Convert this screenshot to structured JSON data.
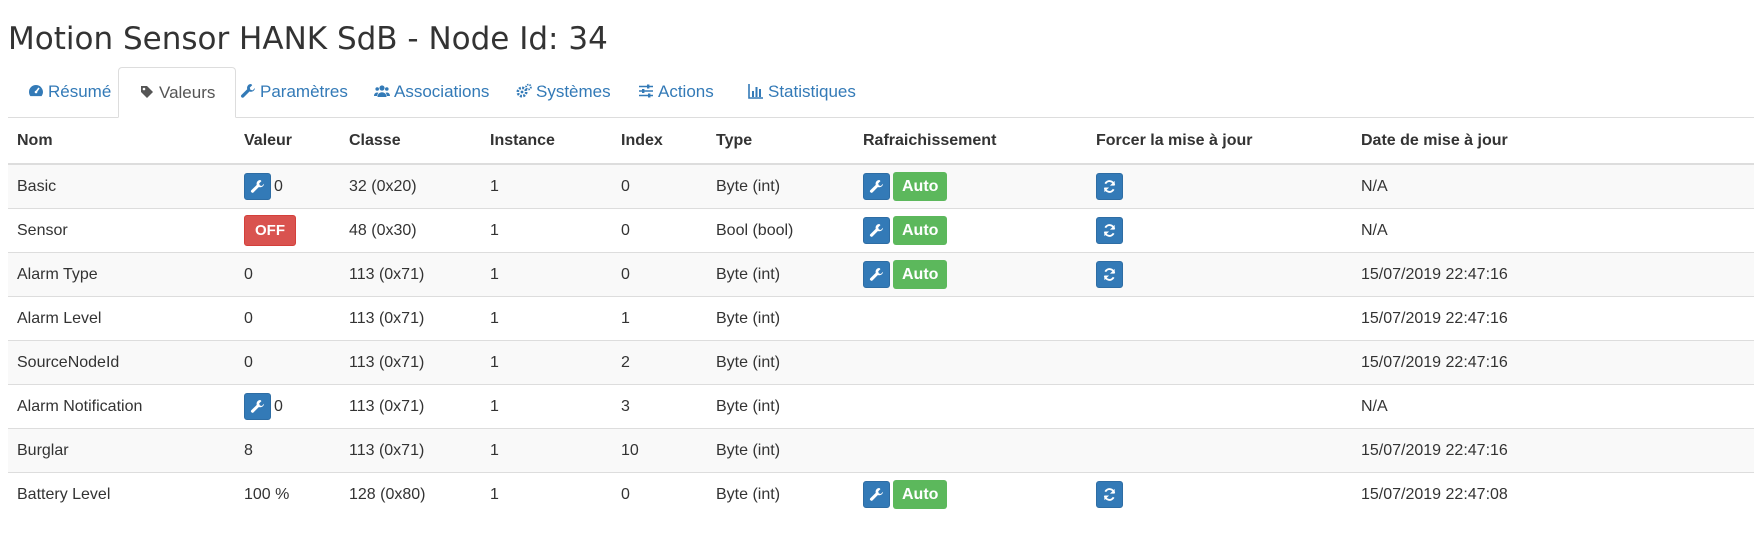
{
  "page": {
    "title": "Motion Sensor HANK SdB - Node Id: 34"
  },
  "tabs": [
    {
      "label": "Résumé",
      "icon": "dashboard-icon"
    },
    {
      "label": "Valeurs",
      "icon": "tag-icon",
      "active": true
    },
    {
      "label": "Paramètres",
      "icon": "wrench-icon"
    },
    {
      "label": "Associations",
      "icon": "users-icon"
    },
    {
      "label": "Systèmes",
      "icon": "cogs-icon"
    },
    {
      "label": "Actions",
      "icon": "sliders-icon"
    },
    {
      "label": "Statistiques",
      "icon": "bar-chart-icon"
    }
  ],
  "table": {
    "headers": [
      "Nom",
      "Valeur",
      "Classe",
      "Instance",
      "Index",
      "Type",
      "Rafraichissement",
      "Forcer la mise à jour",
      "Date de mise à jour"
    ],
    "rows": [
      {
        "name": "Basic",
        "value": "0",
        "class": "32 (0x20)",
        "instance": "1",
        "index": "0",
        "type": "Byte (int)",
        "auto": "Auto",
        "date": "N/A"
      },
      {
        "name": "Sensor",
        "value": "OFF",
        "class": "48 (0x30)",
        "instance": "1",
        "index": "0",
        "type": "Bool (bool)",
        "auto": "Auto",
        "date": "N/A"
      },
      {
        "name": "Alarm Type",
        "value": "0",
        "class": "113 (0x71)",
        "instance": "1",
        "index": "0",
        "type": "Byte (int)",
        "auto": "Auto",
        "date": "15/07/2019 22:47:16"
      },
      {
        "name": "Alarm Level",
        "value": "0",
        "class": "113 (0x71)",
        "instance": "1",
        "index": "1",
        "type": "Byte (int)",
        "date": "15/07/2019 22:47:16"
      },
      {
        "name": "SourceNodeId",
        "value": "0",
        "class": "113 (0x71)",
        "instance": "1",
        "index": "2",
        "type": "Byte (int)",
        "date": "15/07/2019 22:47:16"
      },
      {
        "name": "Alarm Notification",
        "value": "0",
        "class": "113 (0x71)",
        "instance": "1",
        "index": "3",
        "type": "Byte (int)",
        "date": "N/A"
      },
      {
        "name": "Burglar",
        "value": "8",
        "class": "113 (0x71)",
        "instance": "1",
        "index": "10",
        "type": "Byte (int)",
        "date": "15/07/2019 22:47:16"
      },
      {
        "name": "Battery Level",
        "value": "100 %",
        "class": "128 (0x80)",
        "instance": "1",
        "index": "0",
        "type": "Byte (int)",
        "auto": "Auto",
        "date": "15/07/2019 22:47:08"
      }
    ]
  },
  "colors": {
    "primary": "#337ab7",
    "success": "#5cb85c",
    "danger": "#d9534f"
  }
}
